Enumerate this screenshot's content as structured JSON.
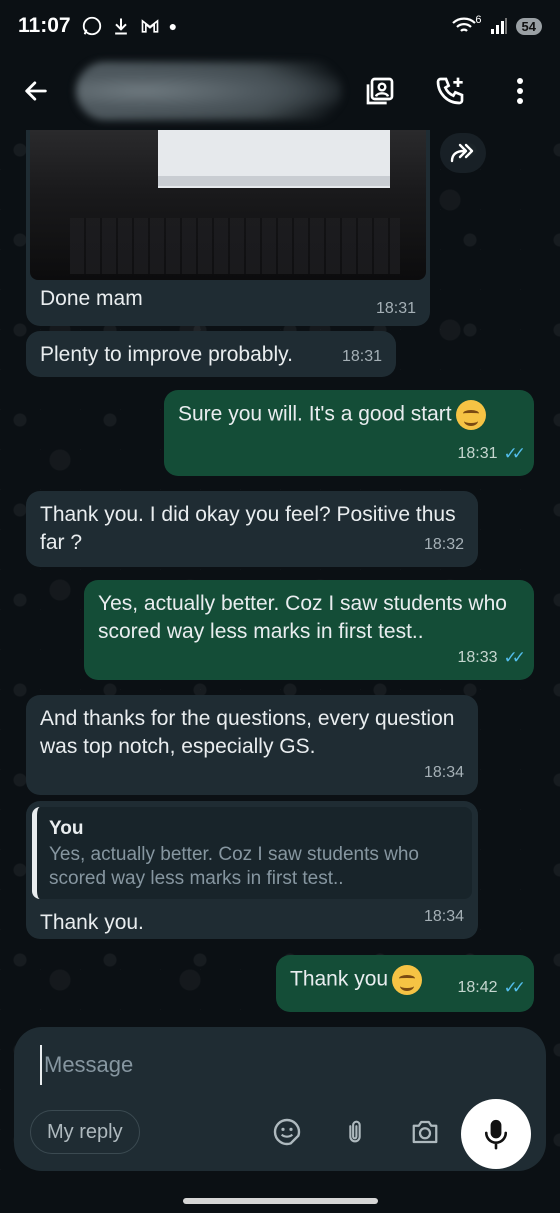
{
  "status_bar": {
    "time": "11:07",
    "battery": "54",
    "network": "6"
  },
  "header": {
    "back_icon": "back-arrow-icon",
    "actions": [
      "contact-card-icon",
      "add-call-icon",
      "more-vert-icon"
    ]
  },
  "messages": [
    {
      "type": "in",
      "text": "Done mam",
      "time": "18:31"
    },
    {
      "type": "in",
      "text": "Plenty to improve probably.",
      "time": "18:31"
    },
    {
      "type": "out",
      "text": "Sure you will. It's a good start",
      "time": "18:31"
    },
    {
      "type": "in",
      "text": "Thank you. I did okay you feel? Positive thus far ?",
      "time": "18:32"
    },
    {
      "type": "out",
      "text": "Yes, actually better. Coz I saw students who scored way less marks in first test..",
      "time": "18:33"
    },
    {
      "type": "in",
      "text": "And thanks for the questions, every question was top notch, especially GS.",
      "time": "18:34"
    },
    {
      "type": "in_reply",
      "quote_author": "You",
      "quote_text": "Yes, actually better. Coz I saw students who scored way less marks in first test..",
      "text": "Thank you.",
      "time": "18:34"
    },
    {
      "type": "out",
      "text": "Thank you",
      "time": "18:42"
    }
  ],
  "composer": {
    "placeholder": "Message",
    "chip": "My reply"
  },
  "colors": {
    "incoming": "#1f2c33",
    "outgoing": "#144d37",
    "read_ticks": "#53bdeb",
    "background": "#0b1014"
  }
}
